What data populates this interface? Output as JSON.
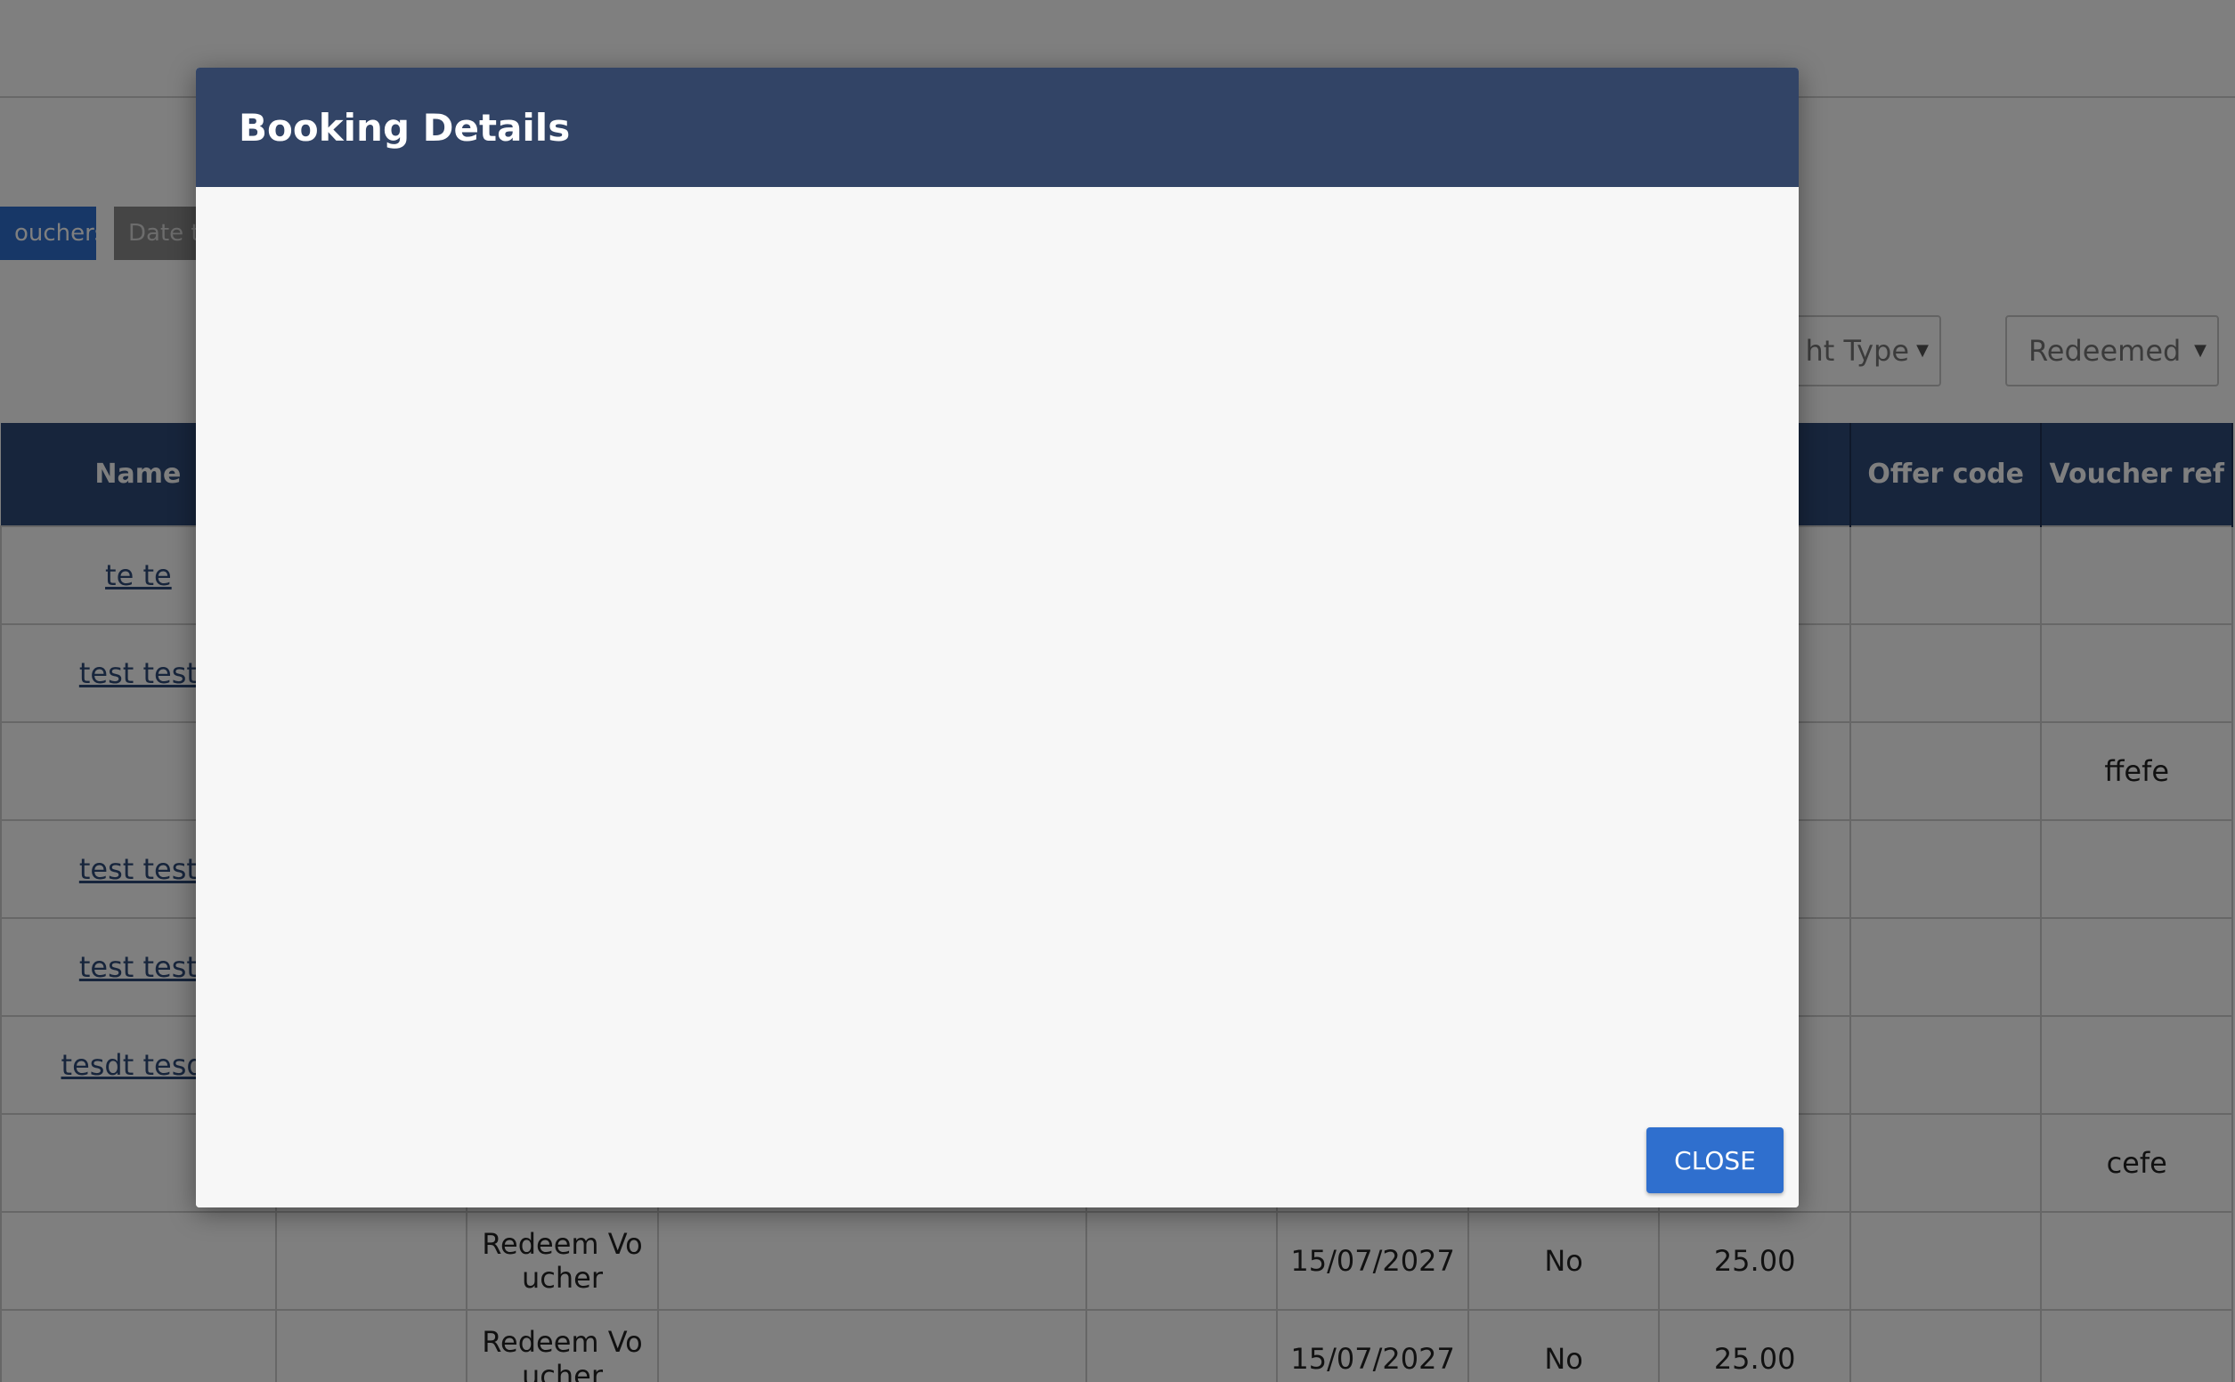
{
  "toolbar": {
    "vouchers_tab": "ouchers",
    "date_tab": "Date t"
  },
  "filters": {
    "type_label": "ht Type",
    "redeemed_label": "Redeemed"
  },
  "table": {
    "headers": [
      "Name",
      "",
      "",
      "",
      "",
      "",
      "",
      "",
      "",
      "Offer code",
      "Voucher ref"
    ],
    "rows": [
      [
        "te te",
        "",
        "",
        "",
        "",
        "",
        "",
        "",
        "",
        "",
        ""
      ],
      [
        "test test",
        "",
        "",
        "",
        "",
        "",
        "",
        "",
        "",
        "",
        ""
      ],
      [
        "",
        "",
        "",
        "",
        "",
        "",
        "",
        "",
        "",
        "",
        "ffefe"
      ],
      [
        "test test",
        "",
        "",
        "",
        "",
        "",
        "",
        "",
        "",
        "",
        ""
      ],
      [
        "test test",
        "",
        "",
        "",
        "",
        "",
        "",
        "",
        "",
        "",
        ""
      ],
      [
        "tesdt tesdt",
        "",
        "",
        "",
        "",
        "",
        "",
        "",
        "",
        "",
        ""
      ],
      [
        "",
        "",
        "",
        "",
        "",
        "",
        "",
        "",
        "",
        "",
        "cefe"
      ],
      [
        "",
        "",
        "Redeem Vo ucher",
        "",
        "",
        "",
        "15/07/2027",
        "No",
        "25.00",
        "",
        ""
      ],
      [
        "",
        "",
        "Redeem Vo ucher",
        "",
        "",
        "",
        "15/07/2027",
        "No",
        "25.00",
        "",
        ""
      ]
    ]
  },
  "modal": {
    "title": "Booking Details",
    "close_label": "CLOSE"
  }
}
